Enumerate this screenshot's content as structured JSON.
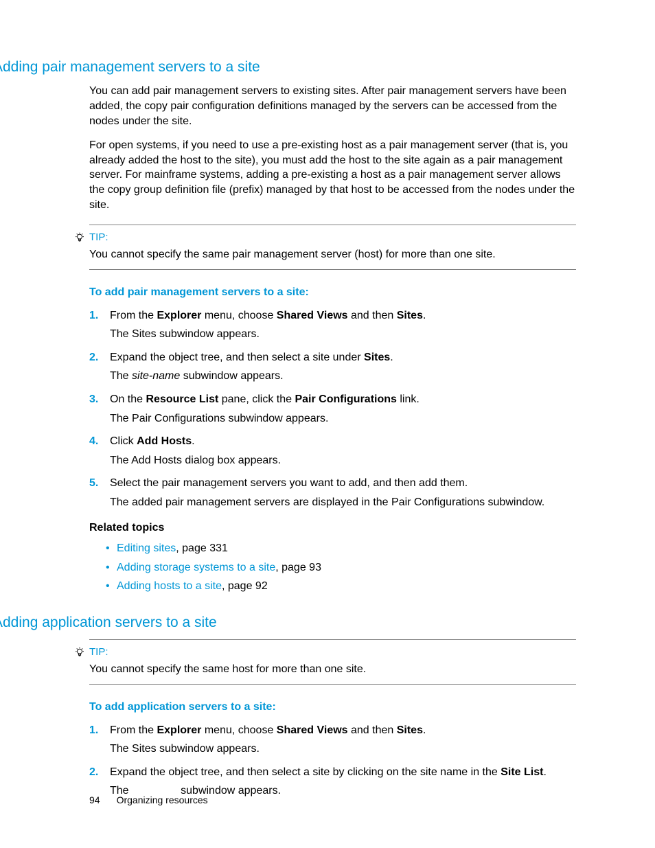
{
  "section1": {
    "heading": "Adding pair management servers to a site",
    "para1": "You can add pair management servers to existing sites. After pair management servers have been added, the copy pair configuration definitions managed by the servers can be accessed from the nodes under the site.",
    "para2": "For open systems, if you need to use a pre-existing host as a pair management server (that is, you already added the host to the site), you must add the host to the site again as a pair management server. For mainframe systems, adding a pre-existing a host as a pair management server allows the copy group definition file (prefix) managed by that host to be accessed from the nodes under the site.",
    "tip_label": "TIP:",
    "tip_body": "You cannot specify the same pair management server (host) for more than one site.",
    "proc_title": "To add pair management servers to a site:",
    "steps": [
      {
        "pre": "From the ",
        "b1": "Explorer",
        "mid1": " menu, choose ",
        "b2": "Shared Views",
        "mid2": " and then ",
        "b3": "Sites",
        "post": ".",
        "sub": "The Sites subwindow appears."
      },
      {
        "pre": "Expand the object tree, and then select a site under ",
        "b1": "Sites",
        "post": ".",
        "sub_pre": "The ",
        "sub_i": "site-name",
        "sub_post": " subwindow appears."
      },
      {
        "pre": "On the ",
        "b1": "Resource List",
        "mid1": " pane, click the ",
        "b2": "Pair Configurations",
        "post": " link.",
        "sub": "The Pair Configurations subwindow appears."
      },
      {
        "pre": "Click ",
        "b1": "Add Hosts",
        "post": ".",
        "sub": "The Add Hosts dialog box appears."
      },
      {
        "main": "Select the pair management servers you want to add, and then add them.",
        "sub": "The added pair management servers are displayed in the Pair Configurations subwindow."
      }
    ],
    "related_title": "Related topics",
    "related": [
      {
        "link": "Editing sites",
        "rest": ", page 331"
      },
      {
        "link": "Adding storage systems to a site",
        "rest": ", page 93"
      },
      {
        "link": "Adding hosts to a site",
        "rest": ", page 92"
      }
    ]
  },
  "section2": {
    "heading": "Adding application servers to a site",
    "tip_label": "TIP:",
    "tip_body": "You cannot specify the same host for more than one site.",
    "proc_title": "To add application servers to a site:",
    "steps": [
      {
        "pre": "From the ",
        "b1": "Explorer",
        "mid1": " menu, choose ",
        "b2": "Shared Views",
        "mid2": " and then ",
        "b3": "Sites",
        "post": ".",
        "sub": "The Sites subwindow appears."
      },
      {
        "pre": "Expand the object tree, and then select a site by clicking on the site name in the ",
        "b1": "Site List",
        "post": ".",
        "sub_pre": "The ",
        "sub_gap": "               ",
        "sub_post": " subwindow appears."
      }
    ]
  },
  "footer": {
    "page": "94",
    "chapter": "Organizing resources"
  }
}
